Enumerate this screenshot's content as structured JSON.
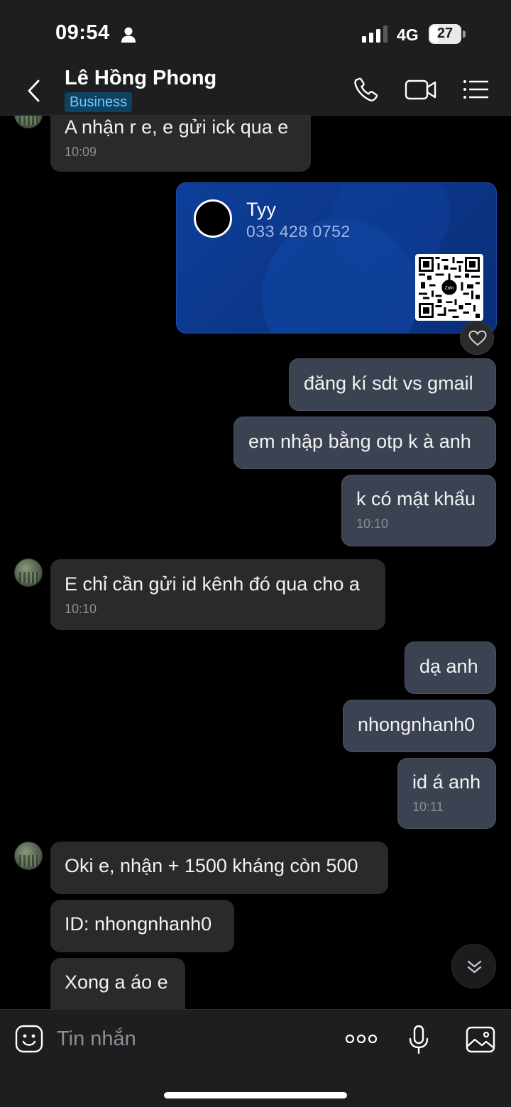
{
  "status_bar": {
    "time": "09:54",
    "network": "4G",
    "battery": "27"
  },
  "header": {
    "contact_name": "Lê Hồng Phong",
    "badge": "Business"
  },
  "card": {
    "name": "Tyy",
    "phone": "033 428 0752",
    "qr_logo": "Zalo"
  },
  "messages": [
    {
      "side": "in",
      "text": "A nhận r e, e gửi ick qua e",
      "time": "10:09"
    },
    {
      "side": "out",
      "text": "đăng kí sdt vs gmail"
    },
    {
      "side": "out",
      "text": "em nhập bằng otp k à anh"
    },
    {
      "side": "out",
      "text": "k có mật khẩu",
      "time": "10:10"
    },
    {
      "side": "in",
      "text": "E chỉ cần gửi id kênh đó qua cho a",
      "time": "10:10"
    },
    {
      "side": "out",
      "text": "dạ anh"
    },
    {
      "side": "out",
      "text": "nhongnhanh0"
    },
    {
      "side": "out",
      "text": "id á anh",
      "time": "10:11"
    },
    {
      "side": "in",
      "text": "Oki e, nhận + 1500 kháng còn 500"
    },
    {
      "side": "in",
      "text": "ID: nhongnhanh0"
    },
    {
      "side": "in",
      "text": "Xong a áo e"
    }
  ],
  "input": {
    "placeholder": "Tin nhắn"
  },
  "icons": [
    "person-icon",
    "signal-icon",
    "back-icon",
    "phone-icon",
    "video-icon",
    "list-menu-icon",
    "heart-icon",
    "chevron-down-double-icon",
    "emoji-icon",
    "more-dots-icon",
    "microphone-icon",
    "image-icon"
  ],
  "colors": {
    "header_bg": "#1e1e20",
    "incoming_bubble": "#2a2a2c",
    "outgoing_bubble": "#3b4352",
    "card_blue": "#0b3688",
    "badge_bg": "#0e4261",
    "badge_text": "#73c6ff"
  }
}
